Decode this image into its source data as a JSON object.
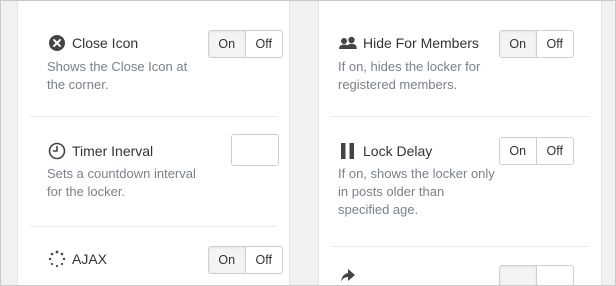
{
  "left_options": [
    {
      "icon": "close-circle-icon",
      "title": "Close Icon",
      "desc": "Shows the Close Icon at the corner.",
      "control": "toggle",
      "on": "On",
      "off": "Off",
      "active": "on"
    },
    {
      "icon": "timer-icon",
      "title": "Timer Inerval",
      "desc": "Sets a countdown interval for the locker.",
      "control": "input",
      "value": ""
    },
    {
      "icon": "loading-spinner-icon",
      "title": "AJAX",
      "desc": "",
      "control": "toggle",
      "on": "On",
      "off": "Off",
      "active": "on"
    }
  ],
  "right_options": [
    {
      "icon": "members-icon",
      "title": "Hide For Members",
      "desc": "If on, hides the locker for registered members.",
      "control": "toggle",
      "on": "On",
      "off": "Off",
      "active": "on"
    },
    {
      "icon": "pause-icon",
      "title": "Lock Delay",
      "desc": "If on, shows the locker only in posts older than specified age.",
      "control": "toggle",
      "on": "On",
      "off": "Off",
      "active": "off"
    },
    {
      "icon": "share-icon",
      "title": "",
      "desc": "",
      "control": "toggle",
      "on": "",
      "off": "",
      "active": "on"
    }
  ],
  "colors": {
    "icon": "#444444",
    "muted_text": "#7b8188",
    "border": "#cfcfcf"
  }
}
